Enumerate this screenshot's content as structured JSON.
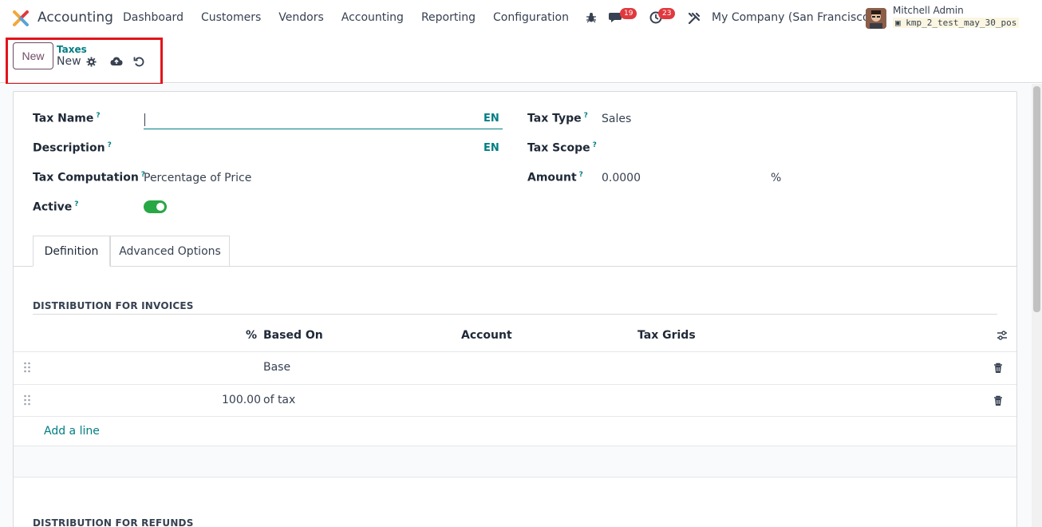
{
  "navbar": {
    "app_name": "Accounting",
    "menu": [
      "Dashboard",
      "Customers",
      "Vendors",
      "Accounting",
      "Reporting",
      "Configuration"
    ],
    "messages_count": "19",
    "activities_count": "23",
    "company": "My Company (San Francisco)",
    "user_name": "Mitchell Admin",
    "database": "kmp_2_test_may_30_pos"
  },
  "control": {
    "new_label": "New",
    "breadcrumb_parent": "Taxes",
    "breadcrumb_current": "New"
  },
  "form": {
    "tax_name_label": "Tax Name",
    "tax_name_value": "",
    "description_label": "Description",
    "lang_badge": "EN",
    "tax_computation_label": "Tax Computation",
    "tax_computation_value": "Percentage of Price",
    "active_label": "Active",
    "active_value": true,
    "tax_type_label": "Tax Type",
    "tax_type_value": "Sales",
    "tax_scope_label": "Tax Scope",
    "amount_label": "Amount",
    "amount_value": "0.0000",
    "amount_unit": "%",
    "help_mark": "?"
  },
  "tabs": [
    {
      "label": "Definition",
      "active": true
    },
    {
      "label": "Advanced Options",
      "active": false
    }
  ],
  "invoices": {
    "title": "DISTRIBUTION FOR INVOICES",
    "columns": [
      "%",
      "Based On",
      "Account",
      "Tax Grids"
    ],
    "rows": [
      {
        "percent": "",
        "based_on": "Base",
        "account": "",
        "tax_grids": ""
      },
      {
        "percent": "100.00",
        "based_on": "of tax",
        "account": "",
        "tax_grids": ""
      }
    ],
    "add_line": "Add a line"
  },
  "refunds": {
    "title": "DISTRIBUTION FOR REFUNDS"
  },
  "colors": {
    "brand": "#714b67",
    "accent": "#017e84",
    "badge": "#e0393e",
    "toggle_on": "#28a745",
    "highlight": "#e3131b"
  },
  "icons": [
    "bug-icon",
    "chat-icon",
    "clock-icon",
    "tools-icon",
    "gear-icon",
    "cloud-upload-icon",
    "undo-icon",
    "drag-handle-icon",
    "trash-icon",
    "column-settings-icon"
  ]
}
